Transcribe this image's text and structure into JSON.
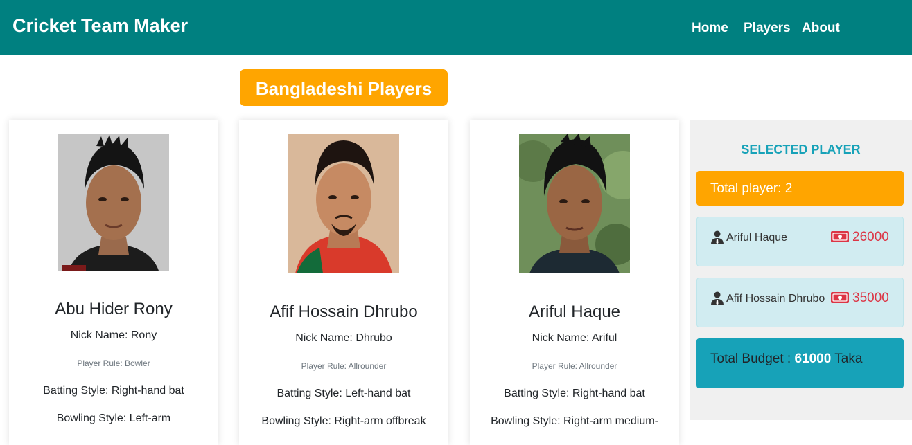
{
  "nav": {
    "brand": "Cricket Team Maker",
    "links": [
      "Home",
      "Players",
      "About"
    ]
  },
  "heading": "Bangladeshi Players",
  "players": [
    {
      "name": "Abu Hider Rony",
      "nick": "Nick Name: Rony",
      "role": "Player Rule: Bowler",
      "batting": "Batting Style: Right-hand bat",
      "bowling": "Bowling Style: Left-arm"
    },
    {
      "name": "Afif Hossain Dhrubo",
      "nick": "Nick Name: Dhrubo",
      "role": "Player Rule: Allrounder",
      "batting": "Batting Style: Left-hand bat",
      "bowling": "Bowling Style: Right-arm offbreak"
    },
    {
      "name": "Ariful Haque",
      "nick": "Nick Name: Ariful",
      "role": "Player Rule: Allrounder",
      "batting": "Batting Style: Right-hand bat",
      "bowling": "Bowling Style: Right-arm medium-"
    }
  ],
  "sidebar": {
    "title": "SELECTED PLAYER",
    "total_player": "Total player: 2",
    "selected": [
      {
        "name": "Ariful Haque",
        "price": "26000",
        "icon": "user-icon",
        "money_icon": "money-icon"
      },
      {
        "name": "Afif Hossain Dhrubo",
        "price": "35000",
        "icon": "user-icon",
        "money_icon": "money-icon"
      }
    ],
    "budget_prefix": "Total Budget :",
    "budget_value": "61000",
    "budget_suffix": "Taka"
  },
  "colors": {
    "navbar": "#008080",
    "accent": "#ffa500",
    "info": "#17a2b8",
    "price": "#dc3545"
  }
}
